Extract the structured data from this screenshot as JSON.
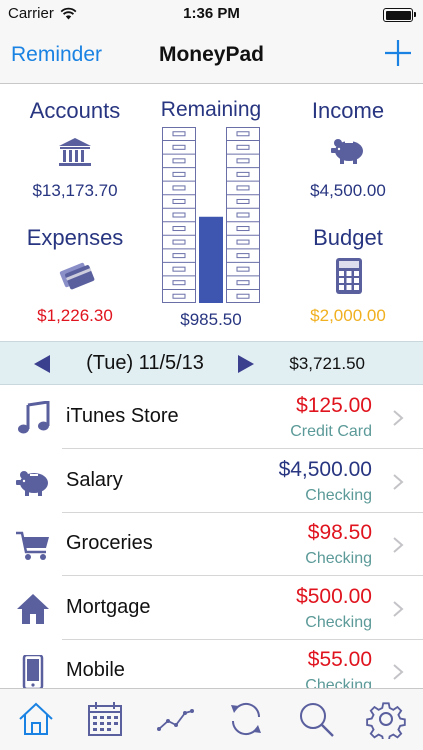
{
  "status": {
    "carrier": "Carrier",
    "time": "1:36 PM"
  },
  "nav": {
    "left": "Reminder",
    "title": "MoneyPad"
  },
  "summary": {
    "accounts": {
      "label": "Accounts",
      "value": "$13,173.70"
    },
    "income": {
      "label": "Income",
      "value": "$4,500.00"
    },
    "expenses": {
      "label": "Expenses",
      "value": "$1,226.30"
    },
    "budget": {
      "label": "Budget",
      "value": "$2,000.00"
    },
    "remaining": {
      "label": "Remaining",
      "value": "$985.50",
      "fill_fraction": 0.49
    }
  },
  "date_bar": {
    "date": "(Tue) 11/5/13",
    "total": "$3,721.50"
  },
  "transactions": [
    {
      "icon": "music-note-icon",
      "name": "iTunes Store",
      "amount": "$125.00",
      "account": "Credit Card",
      "type": "expense"
    },
    {
      "icon": "piggy-bank-icon",
      "name": "Salary",
      "amount": "$4,500.00",
      "account": "Checking",
      "type": "income"
    },
    {
      "icon": "shopping-cart-icon",
      "name": "Groceries",
      "amount": "$98.50",
      "account": "Checking",
      "type": "expense"
    },
    {
      "icon": "house-icon",
      "name": "Mortgage",
      "amount": "$500.00",
      "account": "Checking",
      "type": "expense"
    },
    {
      "icon": "phone-icon",
      "name": "Mobile",
      "amount": "$55.00",
      "account": "Checking",
      "type": "expense"
    }
  ],
  "tabs": [
    "home-icon",
    "calendar-icon",
    "chart-icon",
    "sync-icon",
    "search-icon",
    "gear-icon"
  ],
  "colors": {
    "accent": "#1a82e2",
    "navy": "#283580",
    "expense": "#e0141e",
    "budget": "#f0b020",
    "icon": "#5a5f9e",
    "bar": "#3e56b0",
    "account": "#5b9a98"
  }
}
